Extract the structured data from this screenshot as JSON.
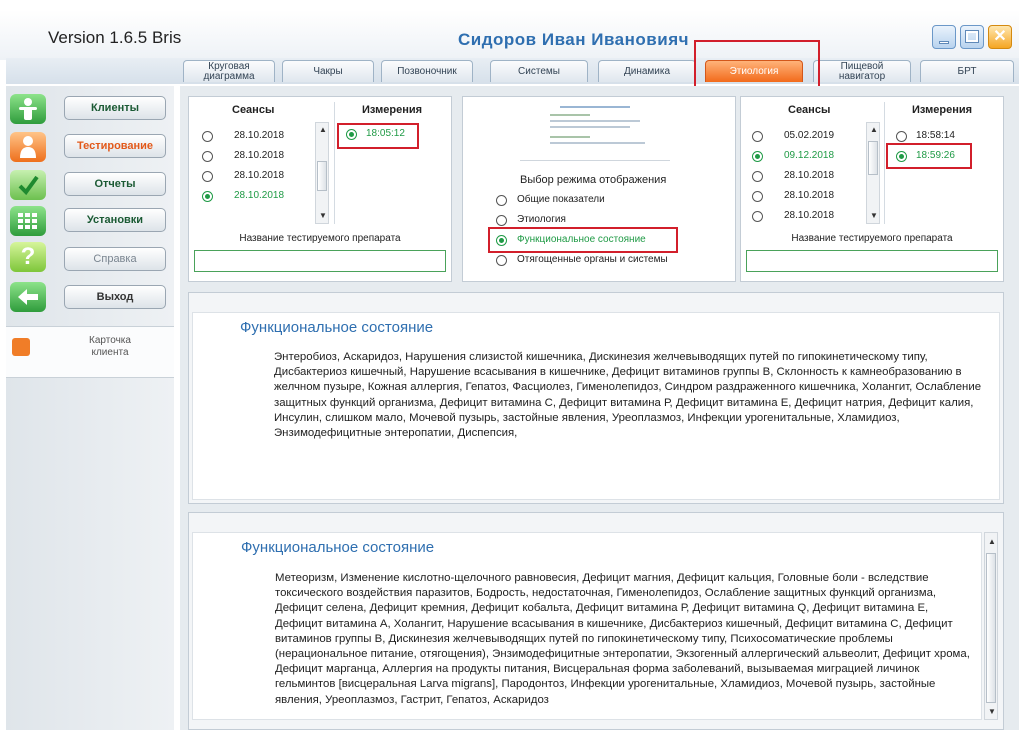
{
  "window": {
    "version": "Version 1.6.5 Bris",
    "user": "Сидоров Иван Иванoвияч",
    "controls": {
      "minimize": "minimize-icon",
      "maximize": "maximize-icon",
      "close": "close-icon"
    }
  },
  "tabs": [
    {
      "label": "Круговая\nдиаграмма"
    },
    {
      "label": "Чакры"
    },
    {
      "label": "Позвоночник"
    },
    {
      "label": "Системы"
    },
    {
      "label": "Динамика"
    },
    {
      "label": "Этиология"
    },
    {
      "label": "Пищевой\nнавигатор"
    },
    {
      "label": "БРТ"
    }
  ],
  "sidebar": {
    "items": [
      {
        "label": "Клиенты",
        "icon": "person-icon"
      },
      {
        "label": "Тестирование",
        "icon": "person-icon"
      },
      {
        "label": "Отчеты",
        "icon": "checkmark-icon"
      },
      {
        "label": "Установки",
        "icon": "grid-icon"
      },
      {
        "label": "Справка",
        "icon": "question-icon"
      },
      {
        "label": "Выход",
        "icon": "arrow-left-icon"
      }
    ],
    "card": {
      "label": "Карточка клиента",
      "icon": "client-card-icon"
    }
  },
  "left_panel": {
    "sessions_header": "Сеансы",
    "measure_header": "Измерения",
    "sessions": [
      "28.10.2018",
      "28.10.2018",
      "28.10.2018",
      "28.10.2018"
    ],
    "selected_session": 3,
    "measurements": [
      "18:05:12"
    ],
    "drug_caption": "Название тестируемого препарата",
    "drug_value": ""
  },
  "mode_panel": {
    "title": "Выбор режима отображения",
    "options": [
      "Общие показатели",
      "Этиология",
      "Функциональное состояние",
      "Отягощенные органы и системы"
    ],
    "selected": 2
  },
  "right_panel": {
    "sessions_header": "Сеансы",
    "measure_header": "Измерения",
    "sessions": [
      "05.02.2019",
      "09.12.2018",
      "28.10.2018",
      "28.10.2018",
      "28.10.2018"
    ],
    "selected_session": 1,
    "measurements": [
      "18:58:14",
      "18:59:26"
    ],
    "selected_measure": 1,
    "drug_caption": "Название тестируемого препарата",
    "drug_value": ""
  },
  "section1": {
    "title": "Функциональное состояние",
    "text": "Энтеробиоз, Аскаридоз, Нарушения слизистой кишечника, Дискинезия желчевыводящих путей по гипокинетическому типу, Дисбактериоз кишечный, Нарушение всасывания в кишечнике, Дефицит витаминов группы В, Склонность к камнеобразованию в желчном пузыре, Кожная аллергия, Гепатоз, Фасциолез, Гименолепидоз, Синдром раздраженного кишечника, Холангит, Ослабление защитных функций организма, Дефицит витамина С, Дефицит витамина Р, Дефицит витамина Е, Дефицит натрия, Дефицит калия, Инсулин, слишком мало, Мочевой пузырь, застойные явления, Уреоплазмоз, Инфекции урогенитальные, Хламидиоз, Энзимодефицитные энтеропатии, Диспепсия,"
  },
  "section2": {
    "title": "Функциональное состояние",
    "text": "Метеоризм, Изменение кислотно-щелочного равновесия, Дефицит магния, Дефицит кальция, Головные боли - вследствие токсического воздействия паразитов, Бодрость, недостаточная, Гименолепидоз, Ослабление защитных функций организма, Дефицит селена, Дефицит кремния, Дефицит кобальта, Дефицит витамина Р, Дефицит витамина Q, Дефицит витамина Е, Дефицит витамина А, Холангит, Нарушение всасывания в кишечнике, Дисбактериоз кишечный, Дефицит витамина С, Дефицит витаминов группы В, Дискинезия желчевыводящих путей по гипокинетическому типу, Психосоматические проблемы (нерациональное питание, отягощения), Энзимодефицитные энтеропатии, Экзогенный аллергический альвеолит, Дефицит хрома, Дефицит марганца, Аллергия на продукты питания, Висцеральная форма заболеваний, вызываемая миграцией личинок гельминтов [висцеральная Larva migrans], Пародонтоз, Инфекции урогенитальные, Хламидиоз, Мочевой пузырь, застойные явления, Уреоплазмоз, Гастрит, Гепатоз, Аскаридоз"
  },
  "colors": {
    "accent": "#2f6fb0",
    "active_tab": "#f26a1b",
    "highlight": "#d21f2b",
    "selected": "#1f9a45"
  }
}
